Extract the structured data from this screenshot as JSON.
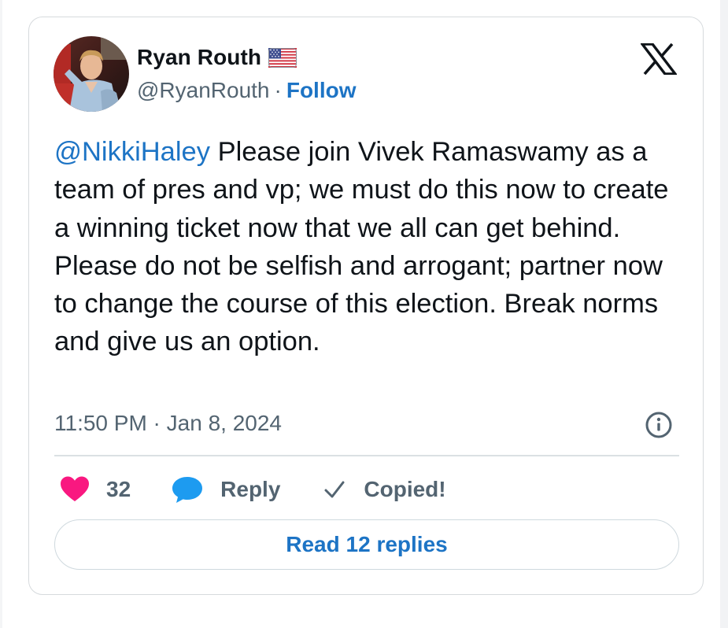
{
  "tweet": {
    "author": {
      "display_name": "Ryan Routh",
      "flag": "us-flag-icon",
      "handle": "@RyanRouth",
      "separator": "·",
      "follow_label": "Follow"
    },
    "brand_icon": "x-logo-icon",
    "mention": "@NikkiHaley",
    "body": " Please join Vivek Ramaswamy as a team  of pres and vp; we must do this now to create a winning ticket now that we all can get behind. Please do not be selfish and arrogant; partner now to change the course of this election. Break norms and give us an option.",
    "timestamp": "11:50 PM · Jan 8, 2024",
    "info_icon": "info-icon",
    "actions": {
      "like_count": "32",
      "reply_label": "Reply",
      "copied_label": "Copied!"
    },
    "read_replies_label": "Read 12 replies"
  },
  "colors": {
    "text_primary": "#0f1419",
    "text_secondary": "#536471",
    "link_blue": "#1d74c5",
    "heart_pink": "#f91880",
    "reply_blue": "#1d9bf0",
    "border": "#d6dadd"
  }
}
